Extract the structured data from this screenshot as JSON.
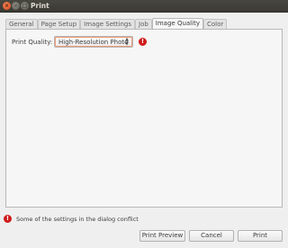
{
  "window": {
    "title": "Print",
    "controls": {
      "close": "×",
      "minimize": "–",
      "maximize": "□"
    }
  },
  "tabs": [
    {
      "label": "General",
      "active": false
    },
    {
      "label": "Page Setup",
      "active": false
    },
    {
      "label": "Image Settings",
      "active": false
    },
    {
      "label": "Job",
      "active": false
    },
    {
      "label": "Image Quality",
      "active": true
    },
    {
      "label": "Color",
      "active": false
    }
  ],
  "image_quality": {
    "print_quality_label": "Print Quality:",
    "print_quality_value": "High-Resolution Photo",
    "conflict_icon": "error-icon",
    "conflict_glyph": "!"
  },
  "status": {
    "icon": "error-icon",
    "glyph": "!",
    "text": "Some of the settings in the dialog conflict"
  },
  "buttons": {
    "print_preview": "Print Preview",
    "cancel": "Cancel",
    "print": "Print"
  },
  "colors": {
    "error": "#d01b1b",
    "focus_outline": "#f19a74",
    "titlebar": "#3b3a34",
    "close_button": "#e2571e"
  }
}
